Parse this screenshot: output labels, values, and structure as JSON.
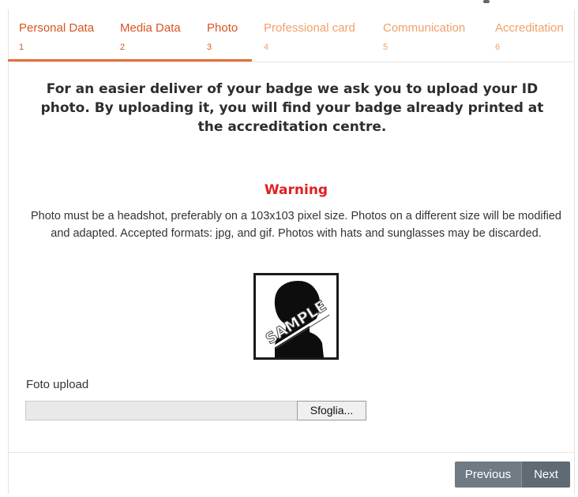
{
  "steps": [
    {
      "label": "Personal Data",
      "number": "1"
    },
    {
      "label": "Media Data",
      "number": "2"
    },
    {
      "label": "Photo",
      "number": "3"
    },
    {
      "label": "Professional card",
      "number": "4"
    },
    {
      "label": "Communication",
      "number": "5"
    },
    {
      "label": "Accreditation",
      "number": "6"
    }
  ],
  "intro": {
    "text": "For an easier deliver of your badge we ask you to upload your ID photo. By uploading it, you will find your badge already printed at the accreditation centre."
  },
  "warning": {
    "title": "Warning",
    "text": "Photo must be a headshot, preferably on a 103x103 pixel size. Photos on a different size will be modified and adapted. Accepted formats: jpg, and gif. Photos with hats and sunglasses may be discarded."
  },
  "sample_image": {
    "watermark": "SAMPLE",
    "icon": "headshot-silhouette-icon"
  },
  "upload": {
    "label": "Foto upload",
    "value": "",
    "browse_label": "Sfoglia..."
  },
  "nav": {
    "previous_label": "Previous",
    "next_label": "Next"
  },
  "colors": {
    "step_accent": "#e8703a",
    "warning": "#e02020",
    "nav_button": "#6f7a82"
  }
}
